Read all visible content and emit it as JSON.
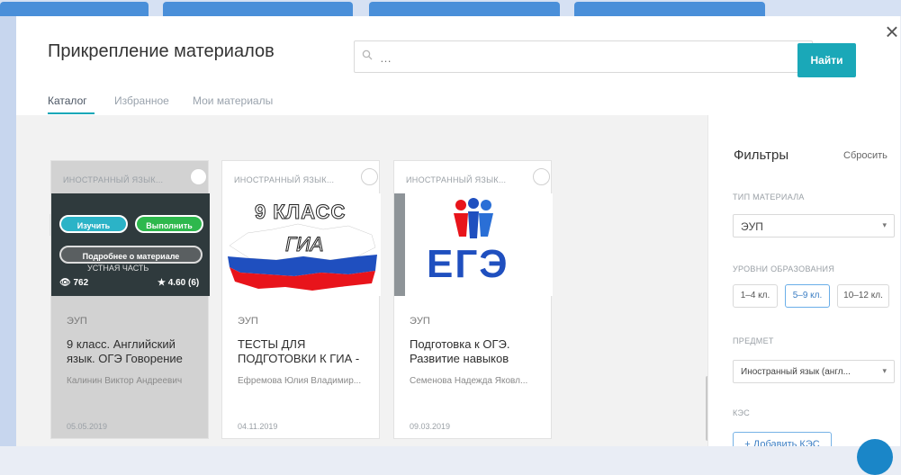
{
  "dialog": {
    "title": "Прикрепление материалов",
    "search_placeholder": "…",
    "find_label": "Найти",
    "close_label": "×"
  },
  "tabs": [
    {
      "label": "Каталог",
      "active": true
    },
    {
      "label": "Избранное",
      "active": false
    },
    {
      "label": "Мои материалы",
      "active": false
    }
  ],
  "cards": [
    {
      "tag": "ИНОСТРАННЫЙ ЯЗЫК...",
      "type": "ЭУП",
      "title": "9 класс. Английский язык. ОГЭ Говорение",
      "author": "Калинин Виктор Андреевич",
      "date": "05.05.2019",
      "views": "762",
      "rating": "4.60 (6)",
      "overlay": {
        "study": "Изучить",
        "do": "Выполнить",
        "details": "Подробнее о материале",
        "caption": "УСТНАЯ ЧАСТЬ"
      }
    },
    {
      "tag": "ИНОСТРАННЫЙ ЯЗЫК...",
      "type": "ЭУП",
      "title": "ТЕСТЫ ДЛЯ ПОДГОТОВКИ К ГИА -",
      "author": "Ефремова Юлия Владимир...",
      "date": "04.11.2019",
      "thumb_text_1": "9 КЛАСС",
      "thumb_text_2": "ГИА"
    },
    {
      "tag": "ИНОСТРАННЫЙ ЯЗЫК...",
      "type": "ЭУП",
      "title": "Подготовка к ОГЭ. Развитие навыков",
      "author": "Семенова Надежда Яковл...",
      "date": "09.03.2019",
      "thumb_text_1": "ЕГЭ"
    }
  ],
  "filters": {
    "title": "Фильтры",
    "reset": "Сбросить",
    "material_type_label": "ТИП МАТЕРИАЛА",
    "material_type_value": "ЭУП",
    "education_level_label": "УРОВНИ ОБРАЗОВАНИЯ",
    "levels": [
      "1–4 кл.",
      "5–9 кл.",
      "10–12 кл."
    ],
    "active_level": "5–9 кл.",
    "subject_label": "ПРЕДМЕТ",
    "subject_value": "Иностранный язык (англ...",
    "kes_label": "КЭС",
    "add_kes": "+ Добавить КЭС"
  },
  "colors": {
    "accent": "#1aa8b8",
    "background_buttons": "#4a8fd9",
    "overlay_study": "#2bb3c7",
    "overlay_do": "#2eb84d",
    "flag_white": "#ffffff",
    "flag_blue": "#1f4fbf",
    "flag_red": "#e8141b"
  }
}
